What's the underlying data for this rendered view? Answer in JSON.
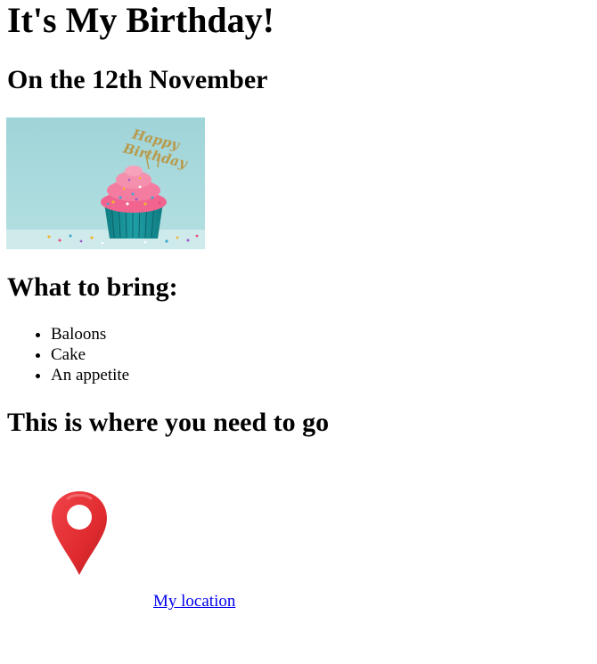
{
  "page": {
    "title": "It's My Birthday!",
    "date_heading": "On the 12th November"
  },
  "image": {
    "alt": "Cupcake with Happy Birthday topper",
    "topper_line1": "Happy",
    "topper_line2": "Birthday"
  },
  "bring": {
    "heading": "What to bring:",
    "items": [
      "Baloons",
      "Cake",
      "An appetite"
    ]
  },
  "location": {
    "heading": "This is where you need to go",
    "link_text": "My location",
    "icon": "map-pin-icon"
  },
  "colors": {
    "link": "#0000ee",
    "pin_red": "#e02b2f",
    "image_bg": "#9fd3d6",
    "frosting": "#f06d9a",
    "cup": "#1a8f96"
  }
}
